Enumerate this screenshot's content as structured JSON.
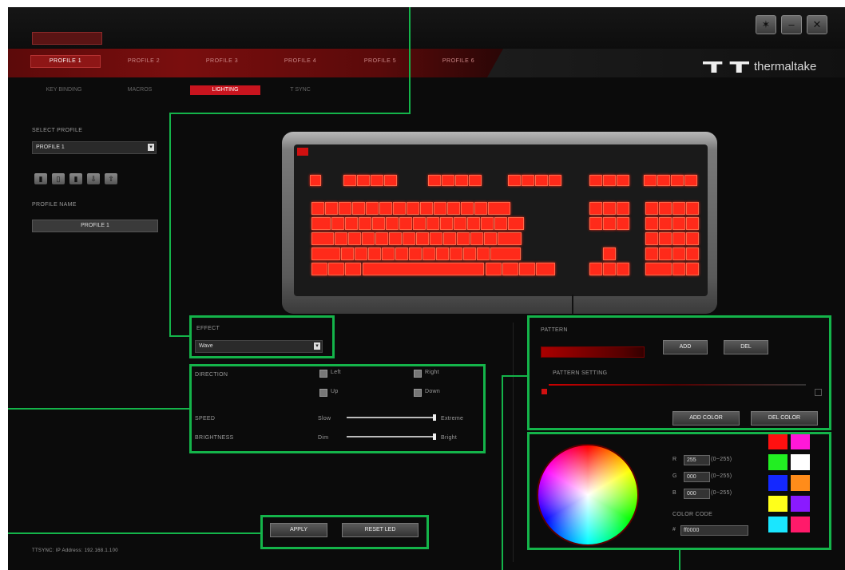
{
  "window": {
    "brand": "thermaltake",
    "controls": [
      "settings",
      "minimize",
      "close"
    ]
  },
  "profile_tabs": [
    "PROFILE 1",
    "PROFILE 2",
    "PROFILE 3",
    "PROFILE 4",
    "PROFILE 5",
    "PROFILE 6"
  ],
  "active_profile_tab": 0,
  "sub_tabs": [
    "KEY BINDING",
    "MACROS",
    "LIGHTING",
    "T SYNC"
  ],
  "active_sub_tab": 2,
  "sidebar": {
    "select_profile_label": "SELECT PROFILE",
    "select_profile_value": "PROFILE 1",
    "icons": [
      "new-file-icon",
      "delete-icon",
      "copy-icon",
      "import-icon",
      "export-icon"
    ],
    "profile_name_label": "PROFILE NAME",
    "profile_name_value": "PROFILE 1"
  },
  "effect": {
    "label": "EFFECT",
    "value": "Wave"
  },
  "direction": {
    "label": "DIRECTION",
    "left": "Left",
    "right": "Right",
    "up": "Up",
    "down": "Down"
  },
  "speed": {
    "label": "SPEED",
    "min": "Slow",
    "max": "Extreme",
    "value": 1.0
  },
  "brightness": {
    "label": "BRIGHTNESS",
    "min": "Dim",
    "max": "Bright",
    "value": 1.0
  },
  "actions": {
    "apply": "APPLY",
    "reset": "RESET LED"
  },
  "status": "TTSYNC: IP Address: 192.168.1.100",
  "pattern": {
    "label": "PATTERN",
    "add": "ADD",
    "del": "DEL",
    "setting_label": "PATTERN SETTING",
    "add_color": "ADD COLOR",
    "del_color": "DEL COLOR"
  },
  "color": {
    "r_label": "R",
    "r_value": "255",
    "r_range": "(0~255)",
    "g_label": "G",
    "g_value": "000",
    "g_range": "(0~255)",
    "b_label": "B",
    "b_value": "000",
    "b_range": "(0~255)",
    "code_label": "COLOR CODE",
    "hash": "#",
    "code_value": "ff0000"
  },
  "swatches": [
    "#ff1010",
    "#ff18d8",
    "#22ee22",
    "#ffffff",
    "#1428ff",
    "#ff8c1a",
    "#ffff1a",
    "#8a1aff",
    "#1ae6ff",
    "#ff1a6a"
  ],
  "accent": "#14b44a"
}
